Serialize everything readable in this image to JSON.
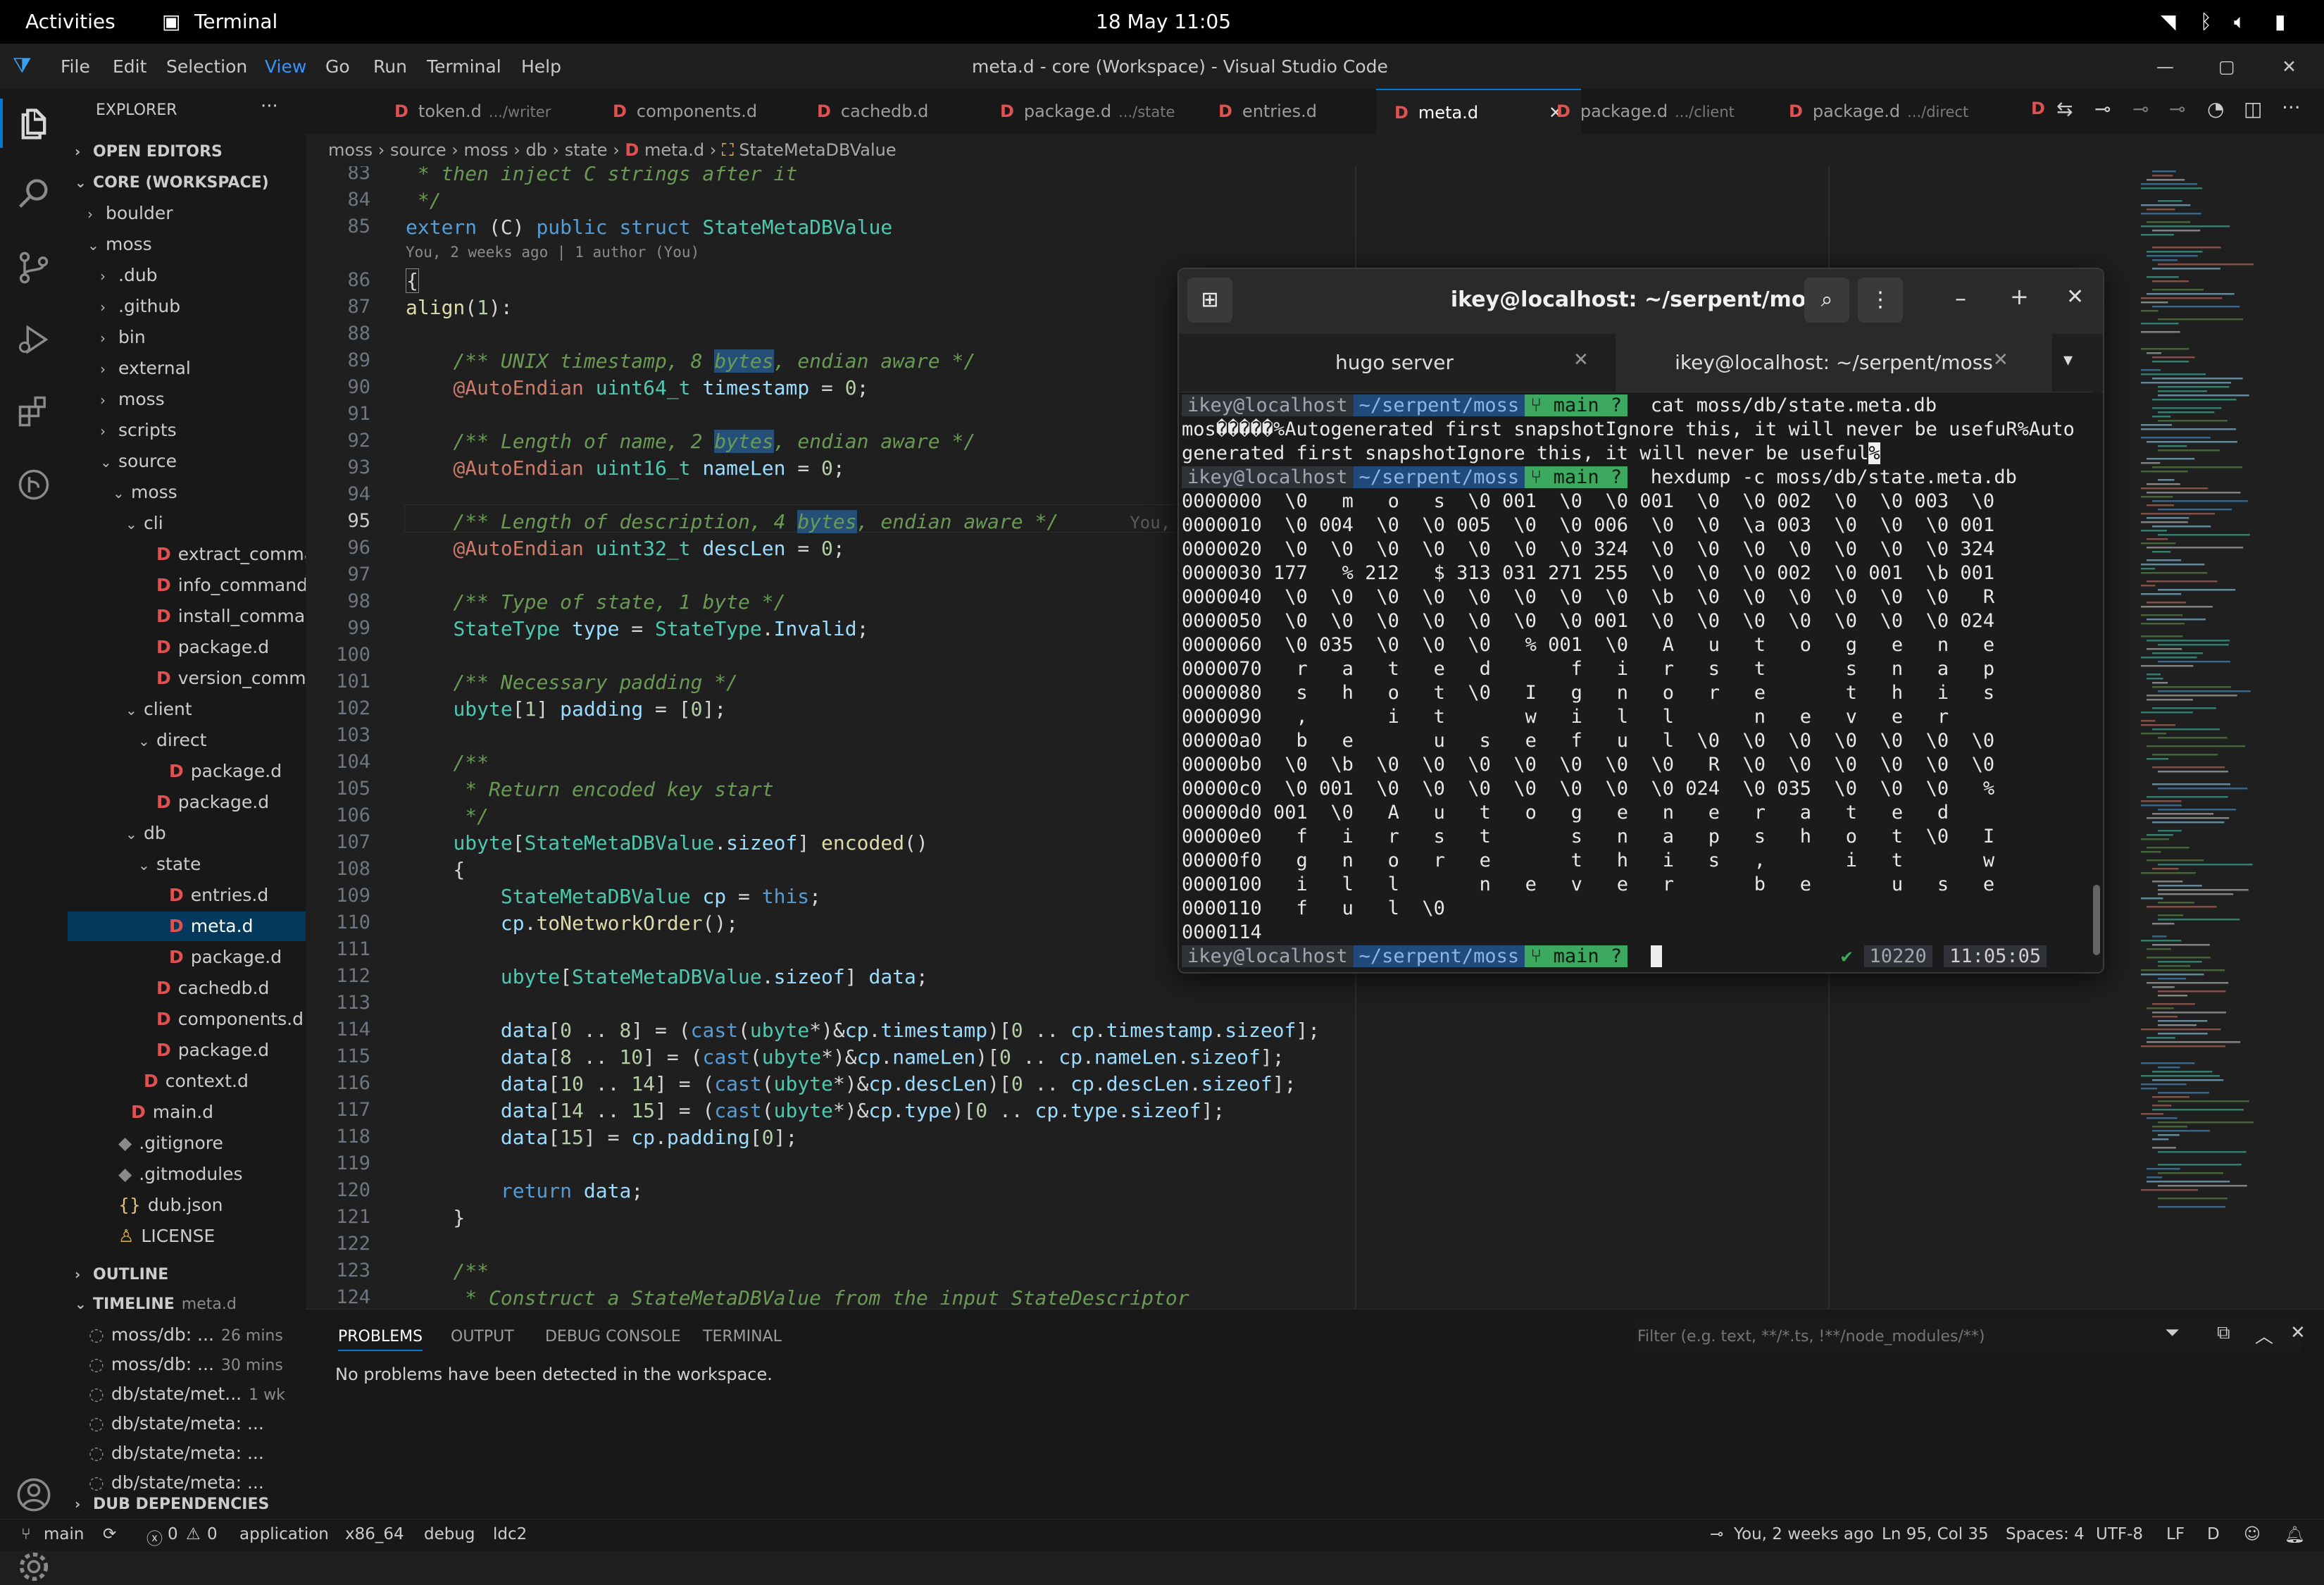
{
  "topbar": {
    "activities": "Activities",
    "app_name": "Terminal",
    "datetime": "18 May  11:05"
  },
  "titlebar": {
    "menu": [
      "File",
      "Edit",
      "Selection",
      "View",
      "Go",
      "Run",
      "Terminal",
      "Help"
    ],
    "window_title": "meta.d - core (Workspace) - Visual Studio Code"
  },
  "sidebar": {
    "header": "EXPLORER",
    "open_editors": "OPEN EDITORS",
    "workspace": "CORE (WORKSPACE)",
    "tree": [
      {
        "label": "boulder",
        "depth": 1,
        "kind": "folder",
        "open": false
      },
      {
        "label": "moss",
        "depth": 1,
        "kind": "folder",
        "open": true
      },
      {
        "label": ".dub",
        "depth": 2,
        "kind": "folder",
        "open": false
      },
      {
        "label": ".github",
        "depth": 2,
        "kind": "folder",
        "open": false
      },
      {
        "label": "bin",
        "depth": 2,
        "kind": "folder",
        "open": false
      },
      {
        "label": "external",
        "depth": 2,
        "kind": "folder",
        "open": false
      },
      {
        "label": "moss",
        "depth": 2,
        "kind": "folder",
        "open": false
      },
      {
        "label": "scripts",
        "depth": 2,
        "kind": "folder",
        "open": false
      },
      {
        "label": "source",
        "depth": 2,
        "kind": "folder",
        "open": true
      },
      {
        "label": "moss",
        "depth": 3,
        "kind": "folder",
        "open": true
      },
      {
        "label": "cli",
        "depth": 4,
        "kind": "folder",
        "open": true
      },
      {
        "label": "extract_comma...",
        "depth": 5,
        "kind": "d"
      },
      {
        "label": "info_command.d",
        "depth": 5,
        "kind": "d"
      },
      {
        "label": "install_comma...",
        "depth": 5,
        "kind": "d"
      },
      {
        "label": "package.d",
        "depth": 5,
        "kind": "d"
      },
      {
        "label": "version_comm...",
        "depth": 5,
        "kind": "d"
      },
      {
        "label": "client",
        "depth": 4,
        "kind": "folder",
        "open": true
      },
      {
        "label": "direct",
        "depth": 5,
        "kind": "folder",
        "open": true
      },
      {
        "label": "package.d",
        "depth": 6,
        "kind": "d"
      },
      {
        "label": "package.d",
        "depth": 5,
        "kind": "d"
      },
      {
        "label": "db",
        "depth": 4,
        "kind": "folder",
        "open": true
      },
      {
        "label": "state",
        "depth": 5,
        "kind": "folder",
        "open": true
      },
      {
        "label": "entries.d",
        "depth": 6,
        "kind": "d"
      },
      {
        "label": "meta.d",
        "depth": 6,
        "kind": "d",
        "selected": true
      },
      {
        "label": "package.d",
        "depth": 6,
        "kind": "d"
      },
      {
        "label": "cachedb.d",
        "depth": 5,
        "kind": "d"
      },
      {
        "label": "components.d",
        "depth": 5,
        "kind": "d"
      },
      {
        "label": "package.d",
        "depth": 5,
        "kind": "d"
      },
      {
        "label": "context.d",
        "depth": 4,
        "kind": "d"
      },
      {
        "label": "main.d",
        "depth": 3,
        "kind": "d"
      },
      {
        "label": ".gitignore",
        "depth": 2,
        "kind": "git"
      },
      {
        "label": ".gitmodules",
        "depth": 2,
        "kind": "git"
      },
      {
        "label": "dub.json",
        "depth": 2,
        "kind": "json"
      },
      {
        "label": "LICENSE",
        "depth": 2,
        "kind": "license"
      }
    ],
    "outline": "OUTLINE",
    "timeline": "TIMELINE",
    "timeline_file": "meta.d",
    "timeline_items": [
      {
        "label": "moss/db: ...",
        "time": "26 mins"
      },
      {
        "label": "moss/db: ...",
        "time": "30 mins"
      },
      {
        "label": "db/state/met...",
        "time": "1 wk"
      },
      {
        "label": "db/state/meta: ...",
        "time": ""
      },
      {
        "label": "db/state/meta: ...",
        "time": ""
      },
      {
        "label": "db/state/meta: ...",
        "time": ""
      }
    ],
    "dub_deps": "DUB DEPENDENCIES"
  },
  "tabs": [
    {
      "label": "token.d",
      "sub": ".../writer"
    },
    {
      "label": "components.d",
      "sub": ""
    },
    {
      "label": "cachedb.d",
      "sub": ""
    },
    {
      "label": "package.d",
      "sub": ".../state"
    },
    {
      "label": "entries.d",
      "sub": ""
    },
    {
      "label": "meta.d",
      "sub": "",
      "active": true
    },
    {
      "label": "package.d",
      "sub": ".../client"
    },
    {
      "label": "package.d",
      "sub": ".../direct"
    }
  ],
  "breadcrumb": [
    "moss",
    "source",
    "moss",
    "db",
    "state",
    "meta.d",
    "StateMetaDBValue"
  ],
  "editor": {
    "blame": "You, 2 weeks ago | 1 author (You)",
    "inline_blame": "You,",
    "line_numbers": [
      "83",
      "84",
      "85",
      "86",
      "87",
      "88",
      "89",
      "90",
      "91",
      "92",
      "93",
      "94",
      "95",
      "96",
      "97",
      "98",
      "99",
      "100",
      "101",
      "102",
      "103",
      "104",
      "105",
      "106",
      "107",
      "108",
      "109",
      "110",
      "111",
      "112",
      "113",
      "114",
      "115",
      "116",
      "117",
      "118",
      "119",
      "120",
      "121",
      "122",
      "123",
      "124"
    ]
  },
  "terminal": {
    "title": "ikey@localhost: ~/serpent/moss",
    "tabs": [
      "hugo server",
      "ikey@localhost: ~/serpent/moss"
    ],
    "prompt": {
      "host": "ikey@localhost",
      "dir": "~/serpent/moss",
      "git": "main ?"
    },
    "cmd1": "cat moss/db/state.meta.db",
    "out1a": "mos�����%Autogenerated first snapshotIgnore this, it will never be usefuR%Auto",
    "out1b": "generated first snapshotIgnore this, it will never be useful",
    "cmd2": "hexdump -c moss/db/state.meta.db",
    "hex": [
      "0000000  \\0   m   o   s  \\0 001  \\0  \\0 001  \\0  \\0 002  \\0  \\0 003  \\0",
      "0000010  \\0 004  \\0  \\0 005  \\0  \\0 006  \\0  \\0  \\a 003  \\0  \\0  \\0 001",
      "0000020  \\0  \\0  \\0  \\0  \\0  \\0  \\0 324  \\0  \\0  \\0  \\0  \\0  \\0  \\0 324",
      "0000030 177   % 212   $ 313 031 271 255  \\0  \\0  \\0 002  \\0 001  \\b 001",
      "0000040  \\0  \\0  \\0  \\0  \\0  \\0  \\0  \\0  \\b  \\0  \\0  \\0  \\0  \\0  \\0   R",
      "0000050  \\0  \\0  \\0  \\0  \\0  \\0  \\0 001  \\0  \\0  \\0  \\0  \\0  \\0  \\0 024",
      "0000060  \\0 035  \\0  \\0  \\0   % 001  \\0   A   u   t   o   g   e   n   e",
      "0000070   r   a   t   e   d       f   i   r   s   t       s   n   a   p",
      "0000080   s   h   o   t  \\0   I   g   n   o   r   e       t   h   i   s",
      "0000090   ,       i   t       w   i   l   l       n   e   v   e   r",
      "00000a0   b   e       u   s   e   f   u   l  \\0  \\0  \\0  \\0  \\0  \\0  \\0",
      "00000b0  \\0  \\b  \\0  \\0  \\0  \\0  \\0  \\0  \\0   R  \\0  \\0  \\0  \\0  \\0  \\0",
      "00000c0  \\0 001  \\0  \\0  \\0  \\0  \\0  \\0  \\0 024  \\0 035  \\0  \\0  \\0   %",
      "00000d0 001  \\0   A   u   t   o   g   e   n   e   r   a   t   e   d",
      "00000e0   f   i   r   s   t       s   n   a   p   s   h   o   t  \\0   I",
      "00000f0   g   n   o   r   e       t   h   i   s   ,       i   t       w",
      "0000100   i   l   l       n   e   v   e   r       b   e       u   s   e",
      "0000110   f   u   l  \\0",
      "0000114"
    ],
    "status_count": "10220",
    "status_time": "11:05:05"
  },
  "panel": {
    "tabs": [
      "PROBLEMS",
      "OUTPUT",
      "DEBUG CONSOLE",
      "TERMINAL"
    ],
    "filter_placeholder": "Filter (e.g. text, **/*.ts, !**/node_modules/**)",
    "message": "No problems have been detected in the workspace."
  },
  "statusbar": {
    "branch": "main",
    "errors": "0",
    "warnings": "0",
    "items": [
      "application",
      "x86_64",
      "debug",
      "ldc2"
    ],
    "blame": "You, 2 weeks ago",
    "position": "Ln 95, Col 35",
    "spaces": "Spaces: 4",
    "encoding": "UTF-8",
    "eol": "LF",
    "lang": "D"
  }
}
